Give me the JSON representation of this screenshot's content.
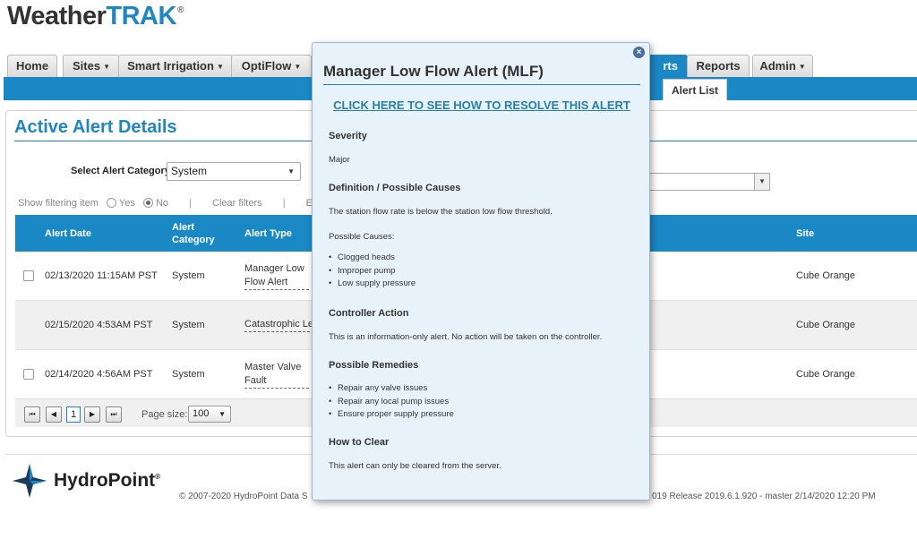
{
  "app": {
    "logo_part1": "Weather",
    "logo_part2": "TRAK",
    "logo_mark": "®"
  },
  "nav": {
    "tabs": [
      {
        "label": "Home",
        "dropdown": false
      },
      {
        "label": "Sites",
        "dropdown": true
      },
      {
        "label": "Smart Irrigation",
        "dropdown": true
      },
      {
        "label": "OptiFlow",
        "dropdown": true
      },
      {
        "label": "rts",
        "dropdown": false,
        "active": true
      },
      {
        "label": "Reports",
        "dropdown": false
      },
      {
        "label": "Admin",
        "dropdown": true
      }
    ],
    "subtab": "Alert List"
  },
  "panel": {
    "title": "Active Alert Details",
    "category_label": "Select Alert Category",
    "category_value": "System",
    "show_filter_label": "Show filtering item",
    "yes_label": "Yes",
    "no_label": "No",
    "clear_filters": "Clear filters",
    "filter_trail": "E",
    "sep": "|"
  },
  "table": {
    "headers": {
      "date": "Alert Date",
      "category": "Alert Category",
      "type": "Alert Type",
      "site": "Site"
    },
    "rows": [
      {
        "date": "02/13/2020 11:15AM PST",
        "category": "System",
        "type": "Manager Low Flow Alert",
        "site": "Cube Orange",
        "checkbox": true
      },
      {
        "date": "02/15/2020 4:53AM PST",
        "category": "System",
        "type": "Catastrophic Lea",
        "site": "Cube Orange",
        "checkbox": false
      },
      {
        "date": "02/14/2020 4:56AM PST",
        "category": "System",
        "type": "Master Valve Fault",
        "site": "Cube Orange",
        "checkbox": true
      }
    ]
  },
  "pager": {
    "page": "1",
    "page_size_label": "Page size:",
    "page_size": "100"
  },
  "footer": {
    "brand": "HydroPoint",
    "brand_mark": "®",
    "copyright": "© 2007-2020 HydroPoint Data S",
    "release": "019 Release 2019.6.1.920 - master 2/14/2020 12:20 PM"
  },
  "popup": {
    "title": "Manager Low Flow Alert (MLF)",
    "resolve_link": "CLICK HERE TO SEE HOW TO RESOLVE THIS ALERT",
    "severity_heading": "Severity",
    "severity": "Major",
    "definition_heading": "Definition / Possible Causes",
    "definition": "The station flow rate is below the station low flow threshold.",
    "causes_label": "Possible Causes:",
    "causes": [
      "Clogged heads",
      "Improper pump",
      "Low supply pressure"
    ],
    "action_heading": "Controller Action",
    "action": "This is an information-only alert. No action will be taken on the controller.",
    "remedies_heading": "Possible Remedies",
    "remedies": [
      "Repair any valve issues",
      "Repair any local pump issues",
      "Ensure proper supply pressure"
    ],
    "clear_heading": "How to Clear",
    "clear": "This alert can only be cleared from the server."
  },
  "colors": {
    "accent": "#1b88c6",
    "popup_bg": "#e8f2fb",
    "link": "#2a7fa8"
  }
}
